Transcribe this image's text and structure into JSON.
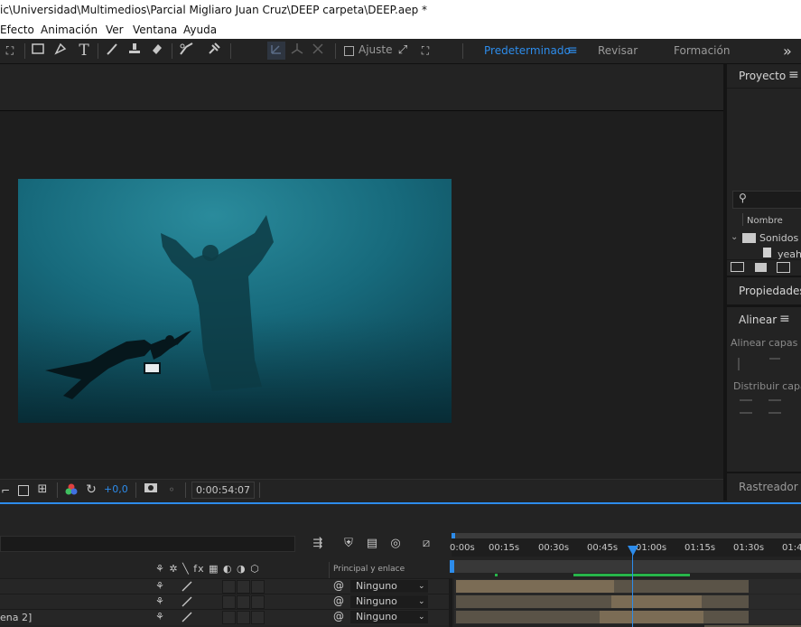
{
  "window": {
    "title": "ic\\Universidad\\Multimedios\\Parcial Migliaro Juan Cruz\\DEEP carpeta\\DEEP.aep *"
  },
  "menu": {
    "items": [
      "Efecto",
      "Animación",
      "Ver",
      "Ventana",
      "Ayuda"
    ]
  },
  "toolbar": {
    "snap_label": "Ajuste"
  },
  "workspaces": {
    "items": [
      "Predeterminado",
      "Revisar",
      "Formación"
    ],
    "more": "»",
    "active_color": "#2d8ceb"
  },
  "viewer": {
    "exposure": "+0,0",
    "timecode": "0:00:54:07"
  },
  "project_panel": {
    "tab": "Proyecto",
    "column_name": "Nombre",
    "folder": "Sonidos",
    "file_partial": "yeah"
  },
  "properties_panel": {
    "tab": "Propiedades: S"
  },
  "align_panel": {
    "tab": "Alinear",
    "align_label": "Alinear capas pa",
    "distribute_label": "Distribuir capas"
  },
  "tracker_panel": {
    "tab": "Rastreador"
  },
  "timeline": {
    "ruler": [
      "0:00s",
      "00:15s",
      "00:30s",
      "00:45s",
      "01:00s",
      "01:15s",
      "01:30s",
      "01:4"
    ],
    "parent_header": "Principal y enlace",
    "layers": [
      {
        "name": "",
        "parent": "Ninguno"
      },
      {
        "name": "",
        "parent": "Ninguno"
      },
      {
        "name": "ena 2]",
        "parent": "Ninguno"
      }
    ],
    "playhead_time_fraction": 0.54
  }
}
